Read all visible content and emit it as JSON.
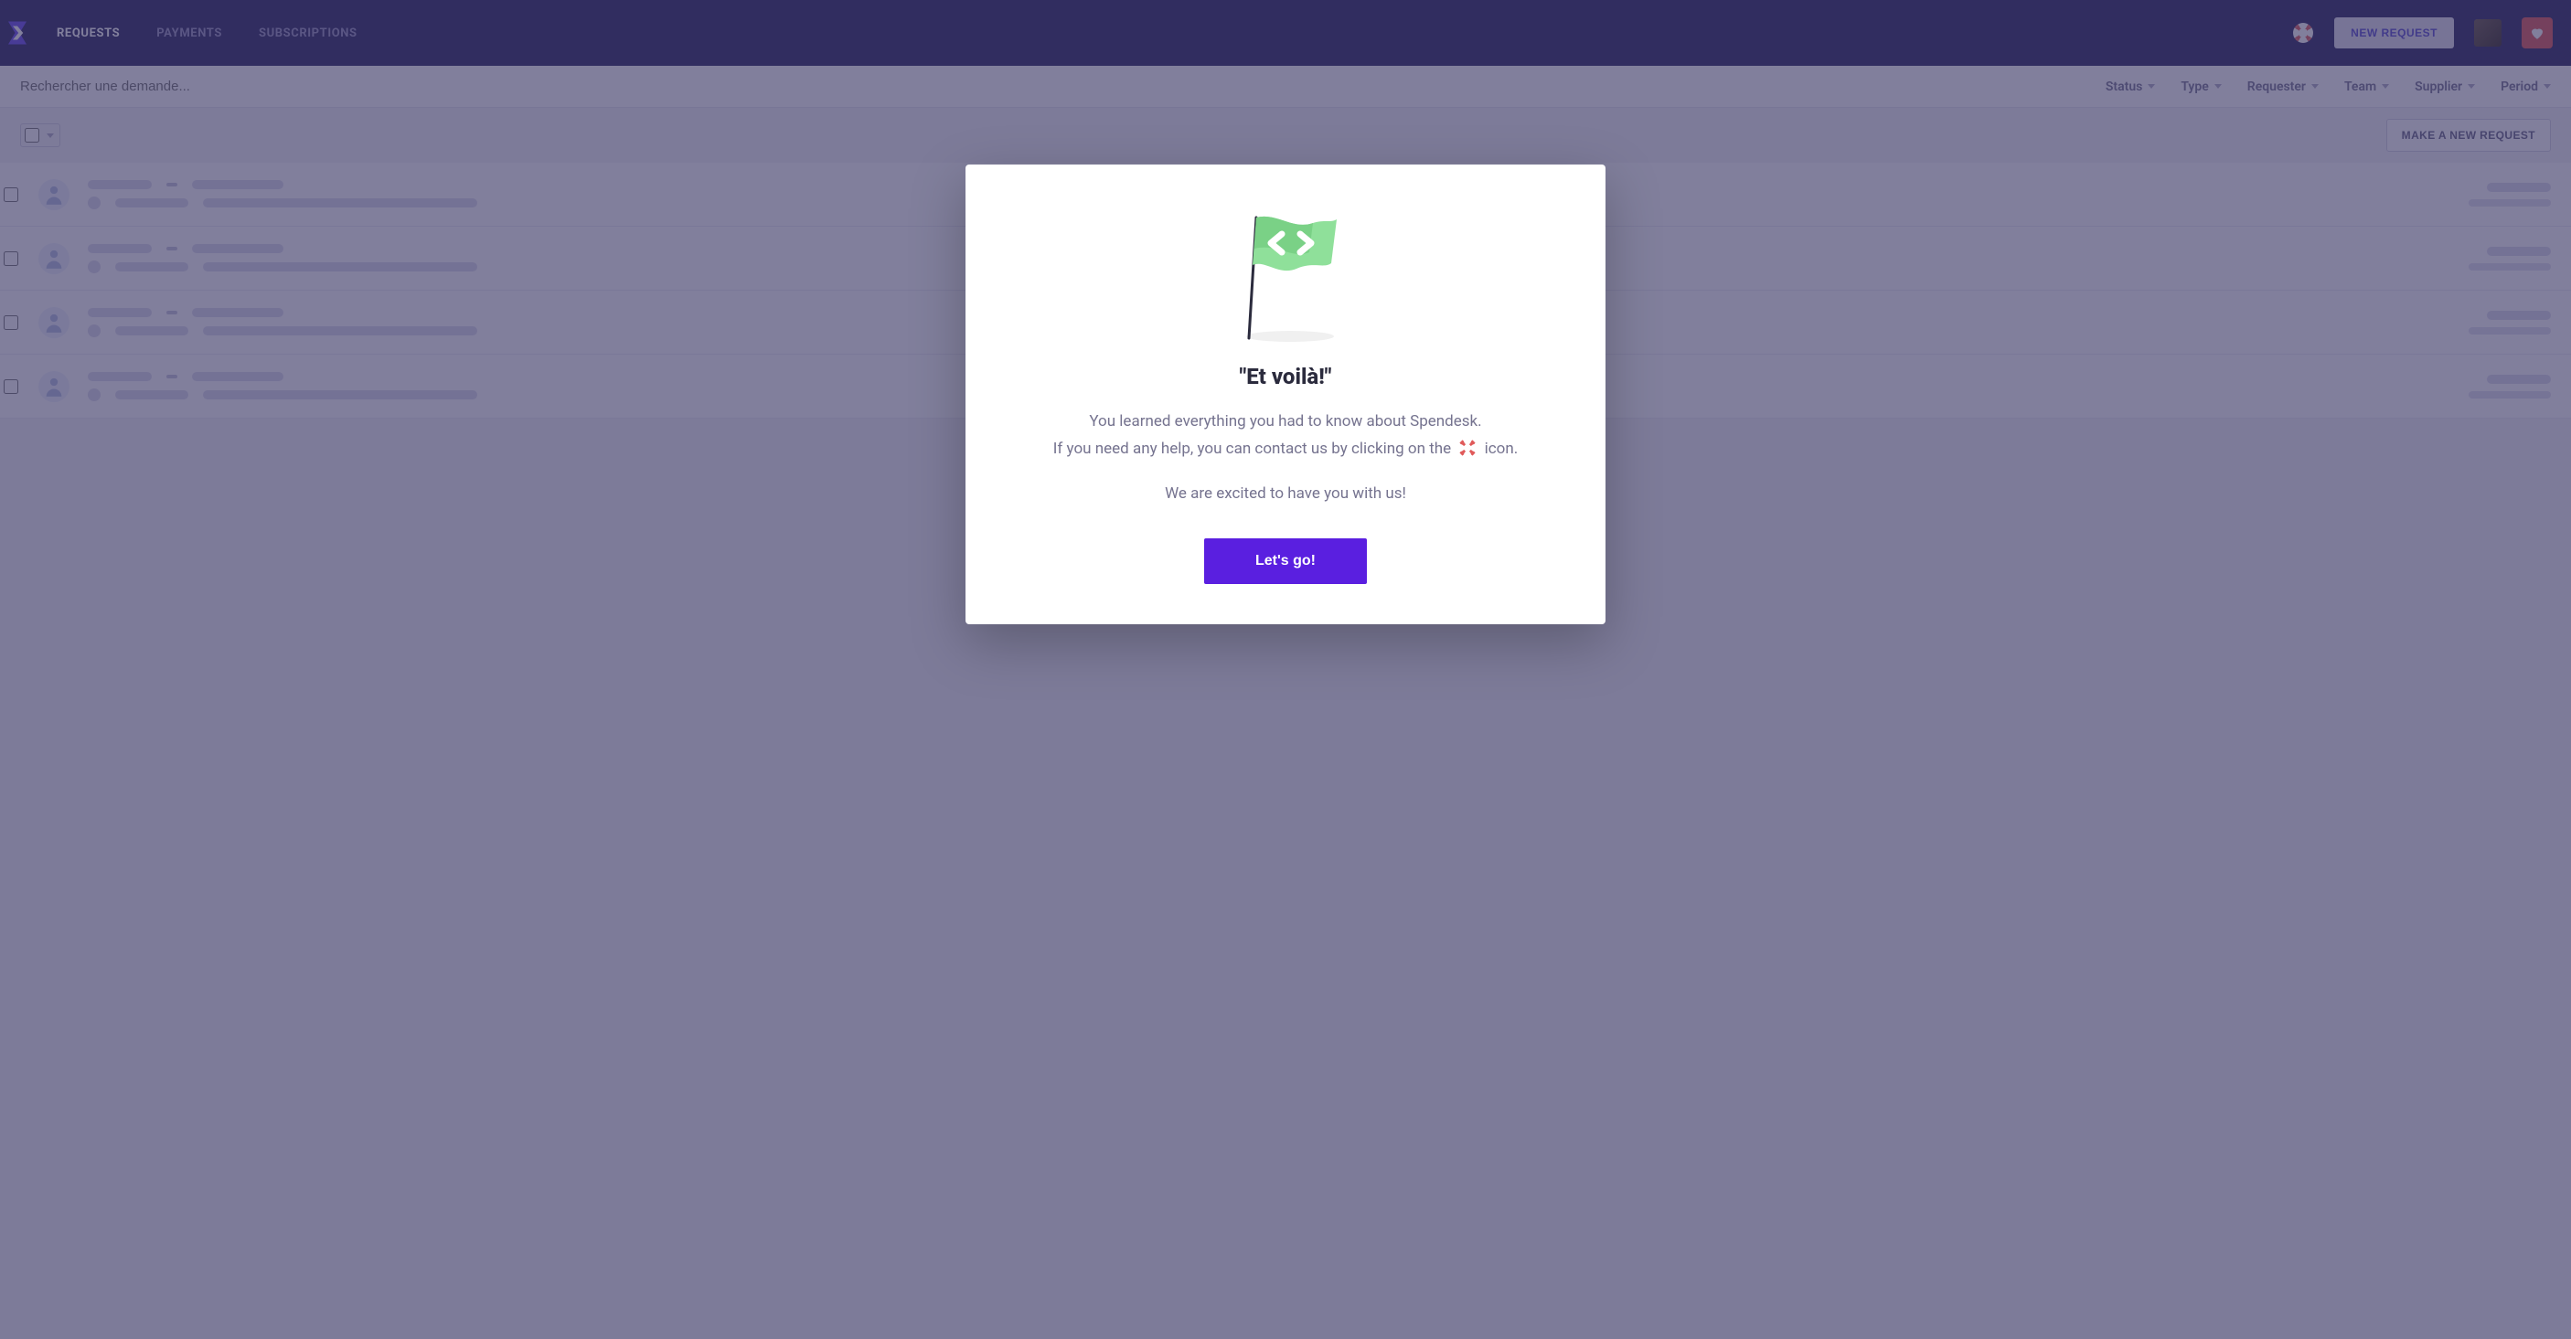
{
  "nav": {
    "tabs": [
      "REQUESTS",
      "PAYMENTS",
      "SUBSCRIPTIONS"
    ],
    "active_index": 0,
    "new_request_btn": "NEW REQUEST"
  },
  "search": {
    "placeholder": "Rechercher une demande..."
  },
  "filters": [
    "Status",
    "Type",
    "Requester",
    "Team",
    "Supplier",
    "Period"
  ],
  "toolbar": {
    "make_request_btn": "MAKE A NEW REQUEST"
  },
  "list": {
    "row_count": 4
  },
  "modal": {
    "title": "\"Et voilà!\"",
    "line1": "You learned everything you had to know about Spendesk.",
    "line2a": "If you need any help, you can contact us by clicking on the ",
    "line2b": " icon.",
    "line3": "We are excited to have you with us!",
    "go_btn": "Let's go!"
  },
  "colors": {
    "primary": "#5a1fe0",
    "nav_bg": "#2e2963",
    "flag_green": "#82d98c"
  }
}
